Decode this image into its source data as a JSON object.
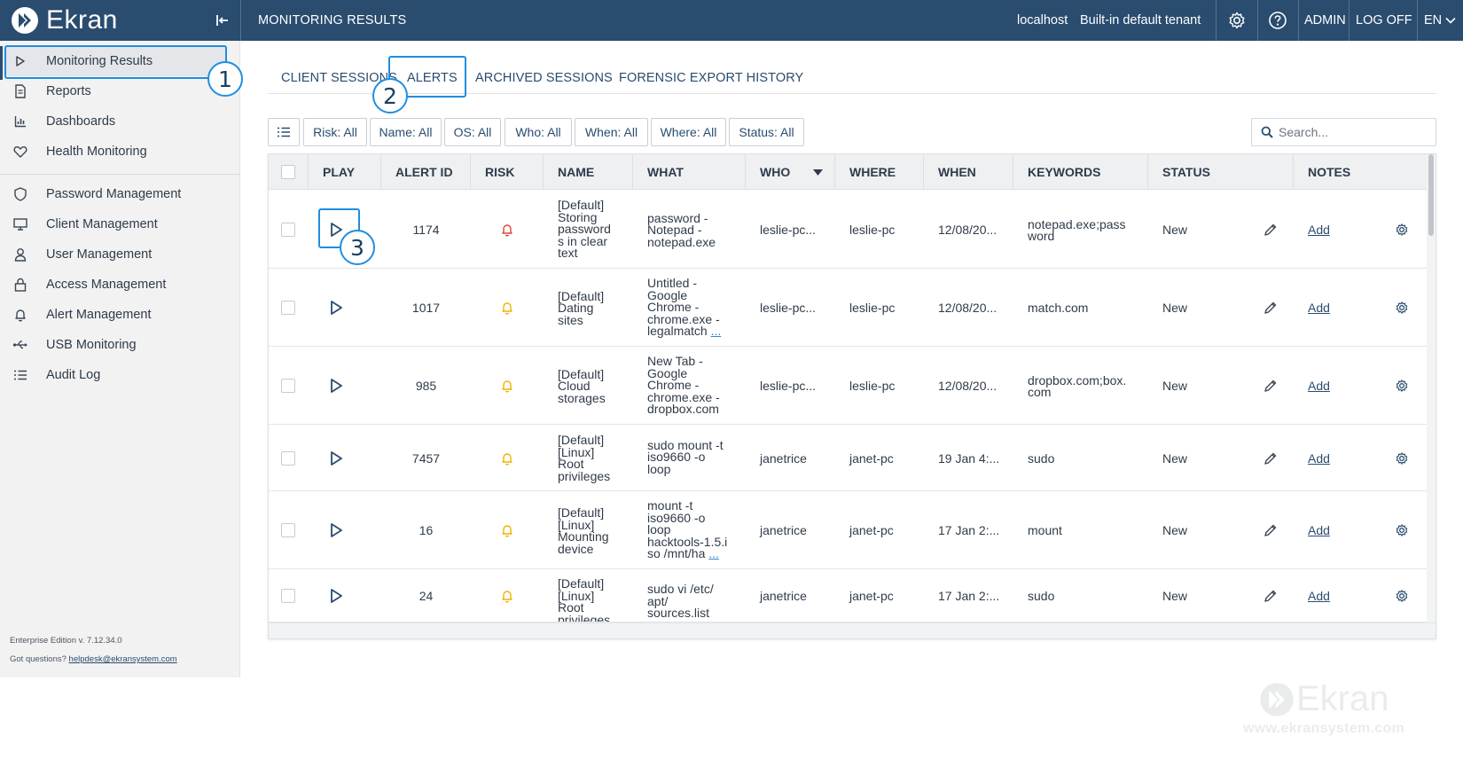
{
  "app": {
    "logo_text": "Ekran",
    "page_heading": "MONITORING RESULTS",
    "server": "localhost",
    "tenant": "Built-in default tenant",
    "user": "ADMIN",
    "logoff": "LOG OFF",
    "language": "EN"
  },
  "sidebar": {
    "items": [
      {
        "label": "Monitoring Results",
        "icon": "play-icon"
      },
      {
        "label": "Reports",
        "icon": "document-icon"
      },
      {
        "label": "Dashboards",
        "icon": "bar-chart-icon"
      },
      {
        "label": "Health Monitoring",
        "icon": "heart-icon"
      },
      {
        "label": "Password Management",
        "icon": "shield-icon"
      },
      {
        "label": "Client Management",
        "icon": "monitor-icon"
      },
      {
        "label": "User Management",
        "icon": "user-icon"
      },
      {
        "label": "Access Management",
        "icon": "lock-icon"
      },
      {
        "label": "Alert Management",
        "icon": "bell-icon"
      },
      {
        "label": "USB Monitoring",
        "icon": "usb-icon"
      },
      {
        "label": "Audit Log",
        "icon": "list-icon"
      }
    ],
    "edition": "Enterprise Edition v. 7.12.34.0",
    "questions_label": "Got questions?",
    "helpdesk_email": "helpdesk@ekransystem.com"
  },
  "tabs": [
    {
      "label": "CLIENT SESSIONS"
    },
    {
      "label": "ALERTS",
      "active": true
    },
    {
      "label": "ARCHIVED SESSIONS"
    },
    {
      "label": "FORENSIC EXPORT HISTORY"
    }
  ],
  "filters": [
    {
      "label": "Risk: All"
    },
    {
      "label": "Name: All"
    },
    {
      "label": "OS: All"
    },
    {
      "label": "Who: All"
    },
    {
      "label": "When: All"
    },
    {
      "label": "Where: All"
    },
    {
      "label": "Status: All"
    }
  ],
  "search": {
    "placeholder": "Search..."
  },
  "table": {
    "columns": {
      "play": "PLAY",
      "alert_id": "ALERT ID",
      "risk": "RISK",
      "name": "NAME",
      "what": "WHAT",
      "who": "WHO",
      "where": "WHERE",
      "when": "WHEN",
      "keywords": "KEYWORDS",
      "status": "STATUS",
      "notes": "NOTES"
    },
    "rows": [
      {
        "id": "1174",
        "risk": "high",
        "name": "[Default] Storing password s in clear text",
        "what": "password - Notepad - notepad.exe",
        "what_more": "",
        "who": "leslie-pc...",
        "where": "leslie-pc",
        "when": "12/08/20...",
        "keywords": "notepad.exe;pass word",
        "status": "New",
        "notes": "Add"
      },
      {
        "id": "1017",
        "risk": "normal",
        "name": "[Default] Dating sites",
        "what": "Untitled - Google Chrome - chrome.exe - legalmatch",
        "what_more": "...",
        "who": "leslie-pc...",
        "where": "leslie-pc",
        "when": "12/08/20...",
        "keywords": "match.com",
        "status": "New",
        "notes": "Add"
      },
      {
        "id": "985",
        "risk": "normal",
        "name": "[Default] Cloud storages",
        "what": "New Tab - Google Chrome - chrome.exe - dropbox.com",
        "what_more": "",
        "who": "leslie-pc...",
        "where": "leslie-pc",
        "when": "12/08/20...",
        "keywords": "dropbox.com;box. com",
        "status": "New",
        "notes": "Add"
      },
      {
        "id": "7457",
        "risk": "normal",
        "name": "[Default] [Linux] Root privileges",
        "what": "sudo mount -t iso9660 -o loop",
        "what_more": "",
        "who": "janetrice",
        "where": "janet-pc",
        "when": "19 Jan 4:...",
        "keywords": "sudo",
        "status": "New",
        "notes": "Add"
      },
      {
        "id": "16",
        "risk": "normal",
        "name": "[Default] [Linux] Mounting device",
        "what": "mount -t iso9660 -o loop hacktools-1.5.i so /mnt/ha",
        "what_more": "...",
        "who": "janetrice",
        "where": "janet-pc",
        "when": "17 Jan 2:...",
        "keywords": "mount",
        "status": "New",
        "notes": "Add"
      },
      {
        "id": "24",
        "risk": "normal",
        "name": "[Default] [Linux] Root privileges",
        "what": "sudo vi /etc/ apt/ sources.list",
        "what_more": "",
        "who": "janetrice",
        "where": "janet-pc",
        "when": "17 Jan 2:...",
        "keywords": "sudo",
        "status": "New",
        "notes": "Add"
      }
    ]
  },
  "annotations": [
    "1",
    "2",
    "3"
  ],
  "watermark": {
    "brand": "Ekran",
    "url": "www.ekransystem.com"
  },
  "colors": {
    "header_bg": "#2a4c6e",
    "accent_highlight": "#1f8ee0",
    "risk_high": "#e0433a",
    "risk_normal": "#f0b400"
  }
}
